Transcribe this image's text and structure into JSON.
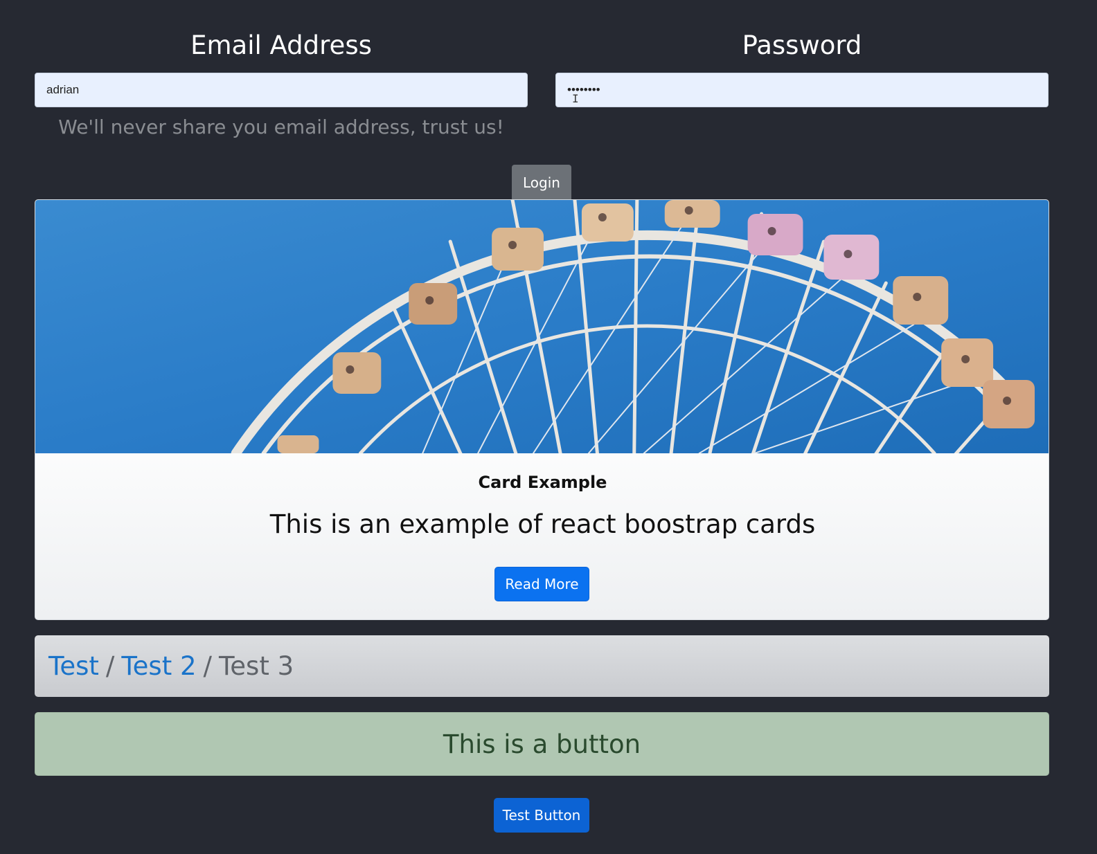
{
  "form": {
    "email_label": "Email Address",
    "email_value": "adrian",
    "password_label": "Password",
    "password_value": "••••••••",
    "help_text": "We'll never share you email address, trust us!",
    "login_label": "Login"
  },
  "card": {
    "image_subject": "ferris-wheel",
    "title": "Card Example",
    "text": "This is an example of react boostrap cards",
    "button_label": "Read More"
  },
  "breadcrumb": {
    "items": [
      "Test",
      "Test 2",
      "Test 3"
    ],
    "separator": "/"
  },
  "alert": {
    "text": "This is a button",
    "color": "#b0c7b2"
  },
  "test_button": {
    "label": "Test Button"
  },
  "colors": {
    "background": "#262932",
    "primary": "#0b72f0",
    "secondary": "#6c7177",
    "input_bg": "#e8f0fe",
    "link": "#1a73c9"
  }
}
